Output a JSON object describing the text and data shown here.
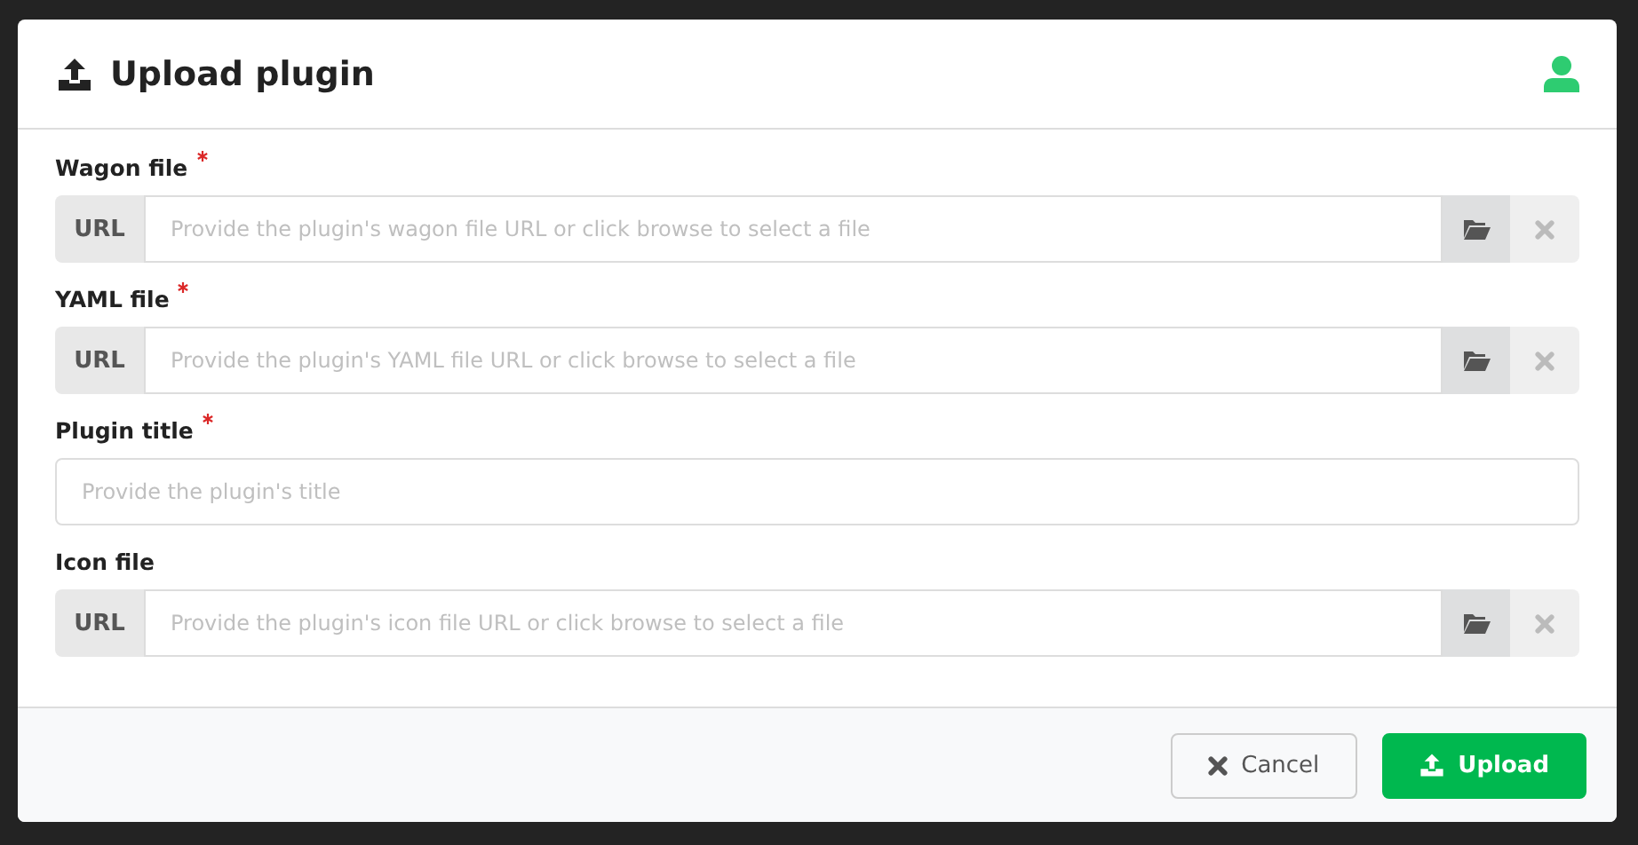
{
  "modal": {
    "title": "Upload plugin"
  },
  "fields": [
    {
      "kind": "url",
      "label": "Wagon file",
      "required": true,
      "addon": "URL",
      "placeholder": "Provide the plugin's wagon file URL or click browse to select a file"
    },
    {
      "kind": "url",
      "label": "YAML file",
      "required": true,
      "addon": "URL",
      "placeholder": "Provide the plugin's YAML file URL or click browse to select a file"
    },
    {
      "kind": "text",
      "label": "Plugin title",
      "required": true,
      "placeholder": "Provide the plugin's title"
    },
    {
      "kind": "url",
      "label": "Icon file",
      "required": false,
      "addon": "URL",
      "placeholder": "Provide the plugin's icon file URL or click browse to select a file"
    }
  ],
  "buttons": [
    {
      "kind": "cancel",
      "label": "Cancel"
    },
    {
      "kind": "upload",
      "label": "Upload"
    }
  ]
}
